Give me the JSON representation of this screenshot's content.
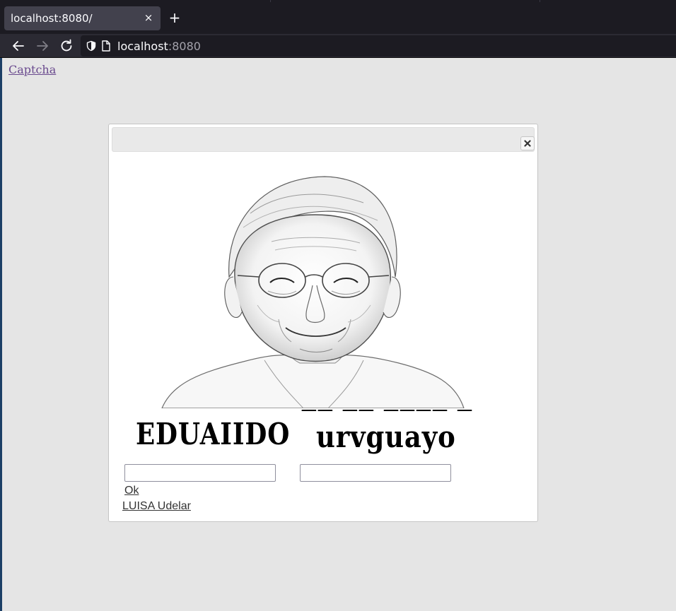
{
  "browser": {
    "tab_title": "localhost:8080/",
    "tab_close_glyph": "×",
    "new_tab_glyph": "+",
    "url_host": "localhost",
    "url_port": ":8080",
    "icons": [
      "back-arrow-icon",
      "forward-arrow-icon",
      "reload-icon",
      "shield-icon",
      "page-icon",
      "close-icon",
      "plus-icon"
    ]
  },
  "page": {
    "link_label": "Captcha",
    "link_color": "#6a4a8e",
    "background": "#e5e5e5"
  },
  "dialog": {
    "close_icon": "close-icon",
    "portrait_image": "pencil-sketch-elderly-woman-with-glasses",
    "captcha": {
      "words": [
        "EDUAIIDO",
        "urvguayo"
      ],
      "input1_value": "",
      "input2_value": ""
    },
    "ok_label": "Ok",
    "footer_link_label": "LUISA Udelar"
  }
}
